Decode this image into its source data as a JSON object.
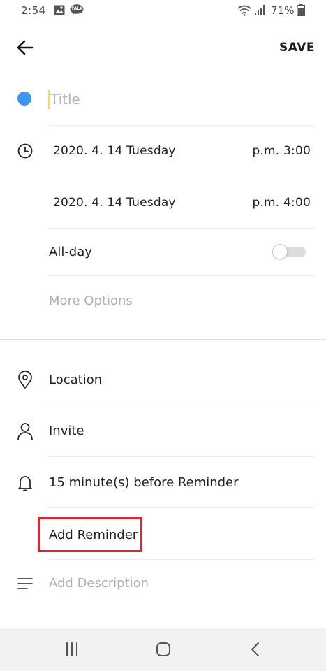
{
  "status_bar": {
    "time": "2:54",
    "icons": [
      "image-icon",
      "talk-icon",
      "wifi-icon",
      "signal-icon",
      "battery-icon"
    ],
    "talk_badge": "TALK",
    "battery_percent": "71%"
  },
  "toolbar": {
    "back_icon": "arrow-left-icon",
    "save_label": "SAVE"
  },
  "event": {
    "color": "#3d97ee",
    "title_value": "",
    "title_placeholder": "Title",
    "start": {
      "date": "2020. 4. 14 Tuesday",
      "time": "p.m. 3:00"
    },
    "end": {
      "date": "2020. 4. 14 Tuesday",
      "time": "p.m. 4:00"
    },
    "all_day_label": "All-day",
    "all_day_on": false,
    "more_options_label": "More Options"
  },
  "details": {
    "location_label": "Location",
    "invite_label": "Invite",
    "reminder_label": "15 minute(s) before Reminder",
    "add_reminder_label": "Add Reminder",
    "description_placeholder": "Add Description"
  },
  "highlight_color": "#e1242e",
  "nav_bar": {
    "buttons": [
      "recent-apps-icon",
      "home-icon",
      "back-icon"
    ]
  }
}
